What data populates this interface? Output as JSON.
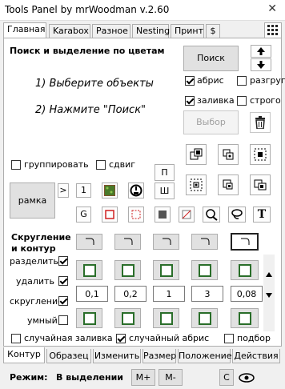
{
  "window": {
    "title": "Tools Panel by mrWoodman v.2.60",
    "close": "✕"
  },
  "top_tabs": [
    "Главная",
    "Karabox",
    "Разное",
    "Nesting",
    "Принт",
    "$"
  ],
  "search": {
    "heading": "Поиск и выделение по цветам",
    "step1": "1) Выберите объекты",
    "step2": "2) Нажмите \"Поиск\"",
    "search_button": "Поиск",
    "select_button": "Выбор",
    "outline_label": "абрис",
    "break_label": "разгруп",
    "fill_label": "заливка",
    "strict_label": "строго"
  },
  "group_label": "группировать",
  "shift_label": "сдвиг",
  "frame": {
    "button": "рамка",
    "more": ">",
    "one": "1",
    "p": "П",
    "w": "Ш",
    "g": "G"
  },
  "rounding": {
    "heading": "Скругление\nи контур",
    "separate_label": "разделить",
    "delete_label": "удалить",
    "round_label": "скругление",
    "smart_label": "умный",
    "values": [
      "0,1",
      "0,2",
      "1",
      "3",
      "0,08"
    ]
  },
  "random_fill_label": "случайная заливка",
  "random_outline_label": "случайный абрис",
  "fit_label": "подбор",
  "bottom_tabs": [
    "Контур",
    "Образец",
    "Изменить",
    "Размер",
    "Положение",
    "Действия"
  ],
  "status": {
    "mode_label": "Режим:",
    "mode_value": "В выделении",
    "m_plus": "M+",
    "m_minus": "M-",
    "c": "C"
  },
  "colors": {
    "accent_green": "#2a6e2a",
    "red": "#d02020"
  }
}
